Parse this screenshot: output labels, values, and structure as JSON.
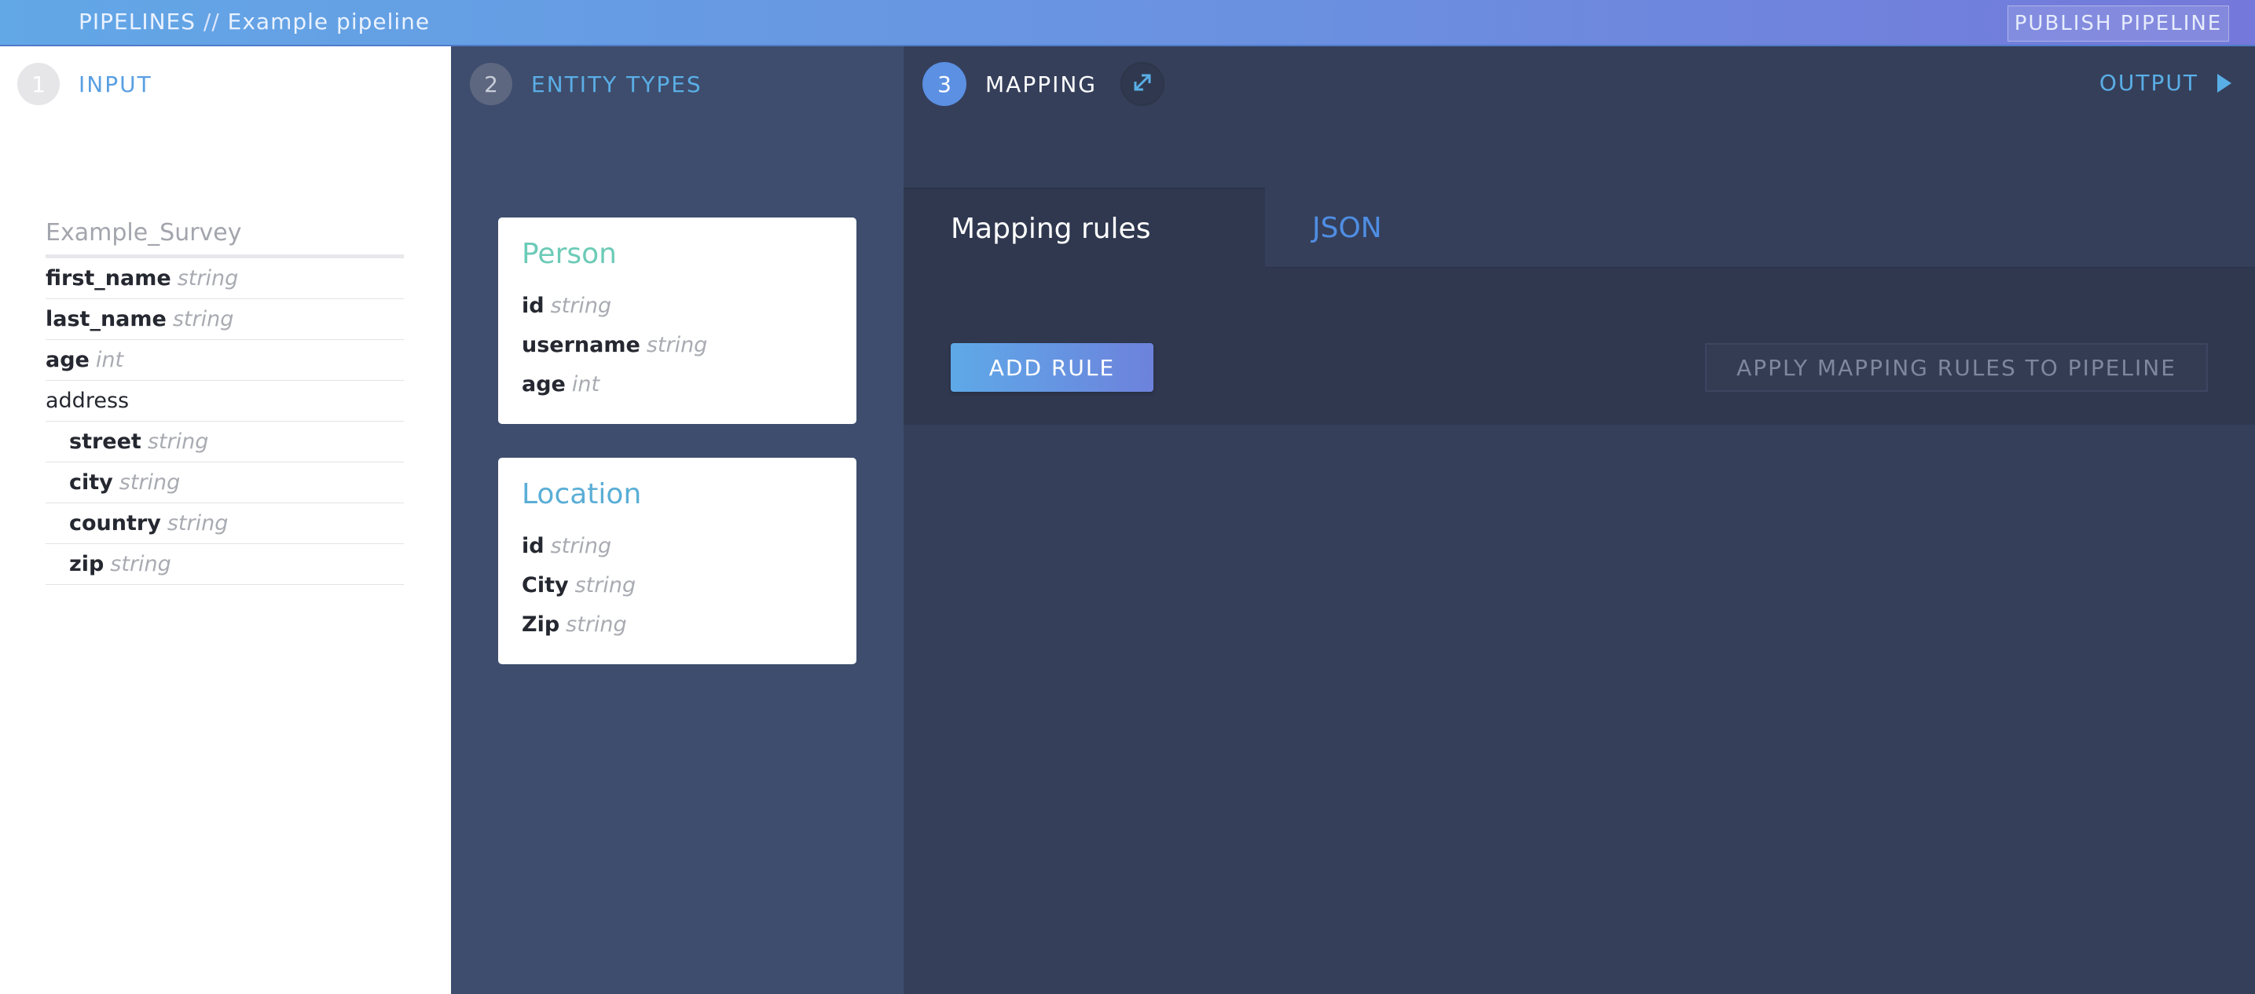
{
  "header": {
    "section": "PIPELINES",
    "separator": " // ",
    "pipeline_name": "Example pipeline",
    "publish_label": "PUBLISH PIPELINE"
  },
  "steps": {
    "input": {
      "number": "1",
      "label": "INPUT"
    },
    "entity_types": {
      "number": "2",
      "label": "ENTITY TYPES"
    },
    "mapping": {
      "number": "3",
      "label": "MAPPING"
    },
    "output": {
      "label": "OUTPUT"
    }
  },
  "input": {
    "schema_title": "Example_Survey",
    "fields": [
      {
        "name": "first_name",
        "type": "string"
      },
      {
        "name": "last_name",
        "type": "string"
      },
      {
        "name": "age",
        "type": "int"
      },
      {
        "name": "address",
        "type": ""
      },
      {
        "name": "street",
        "type": "string"
      },
      {
        "name": "city",
        "type": "string"
      },
      {
        "name": "country",
        "type": "string"
      },
      {
        "name": "zip",
        "type": "string"
      }
    ]
  },
  "entities": [
    {
      "name": "Person",
      "fields": [
        {
          "name": "id",
          "type": "string"
        },
        {
          "name": "username",
          "type": "string"
        },
        {
          "name": "age",
          "type": "int"
        }
      ]
    },
    {
      "name": "Location",
      "fields": [
        {
          "name": "id",
          "type": "string"
        },
        {
          "name": "City",
          "type": "string"
        },
        {
          "name": "Zip",
          "type": "string"
        }
      ]
    }
  ],
  "mapping": {
    "tabs": [
      "Mapping rules",
      "JSON"
    ],
    "add_rule_label": "ADD RULE",
    "apply_label": "APPLY MAPPING RULES TO PIPELINE"
  },
  "colors": {
    "header_gradient_start": "#62a7e6",
    "header_gradient_end": "#7478da",
    "accent_blue": "#5aaee6",
    "person_title": "#6ccbb7",
    "location_title": "#5aaed6",
    "entity_panel": "#3e4d6d",
    "mapping_panel": "#353f5a"
  },
  "icons": {
    "expand": "expand-arrows-icon",
    "output": "triangle-right-icon"
  }
}
